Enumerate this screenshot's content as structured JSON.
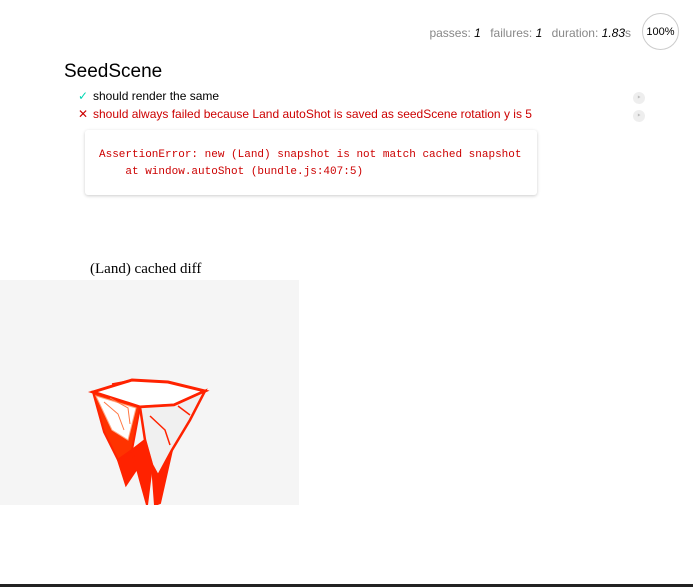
{
  "stats": {
    "passes_label": "passes:",
    "passes_value": "1",
    "failures_label": "failures:",
    "failures_value": "1",
    "duration_label": "duration:",
    "duration_value": "1.83",
    "duration_unit": "s",
    "progress": "100%"
  },
  "suite": {
    "title": "SeedScene",
    "tests": [
      {
        "state": "passed",
        "mark": "✓",
        "title": "should render the same"
      },
      {
        "state": "failed",
        "mark": "✕",
        "title": "should always failed because Land autoShot is saved as seedScene rotation y is 5"
      }
    ],
    "error": "AssertionError: new (Land) snapshot is not match cached snapshot\n    at window.autoShot (bundle.js:407:5)",
    "replay_icon": "replay-icon"
  },
  "snapshot": {
    "caption": "(Land) cached diff",
    "colors": {
      "diff": "#ff2200",
      "background": "#f5f5f5"
    }
  }
}
